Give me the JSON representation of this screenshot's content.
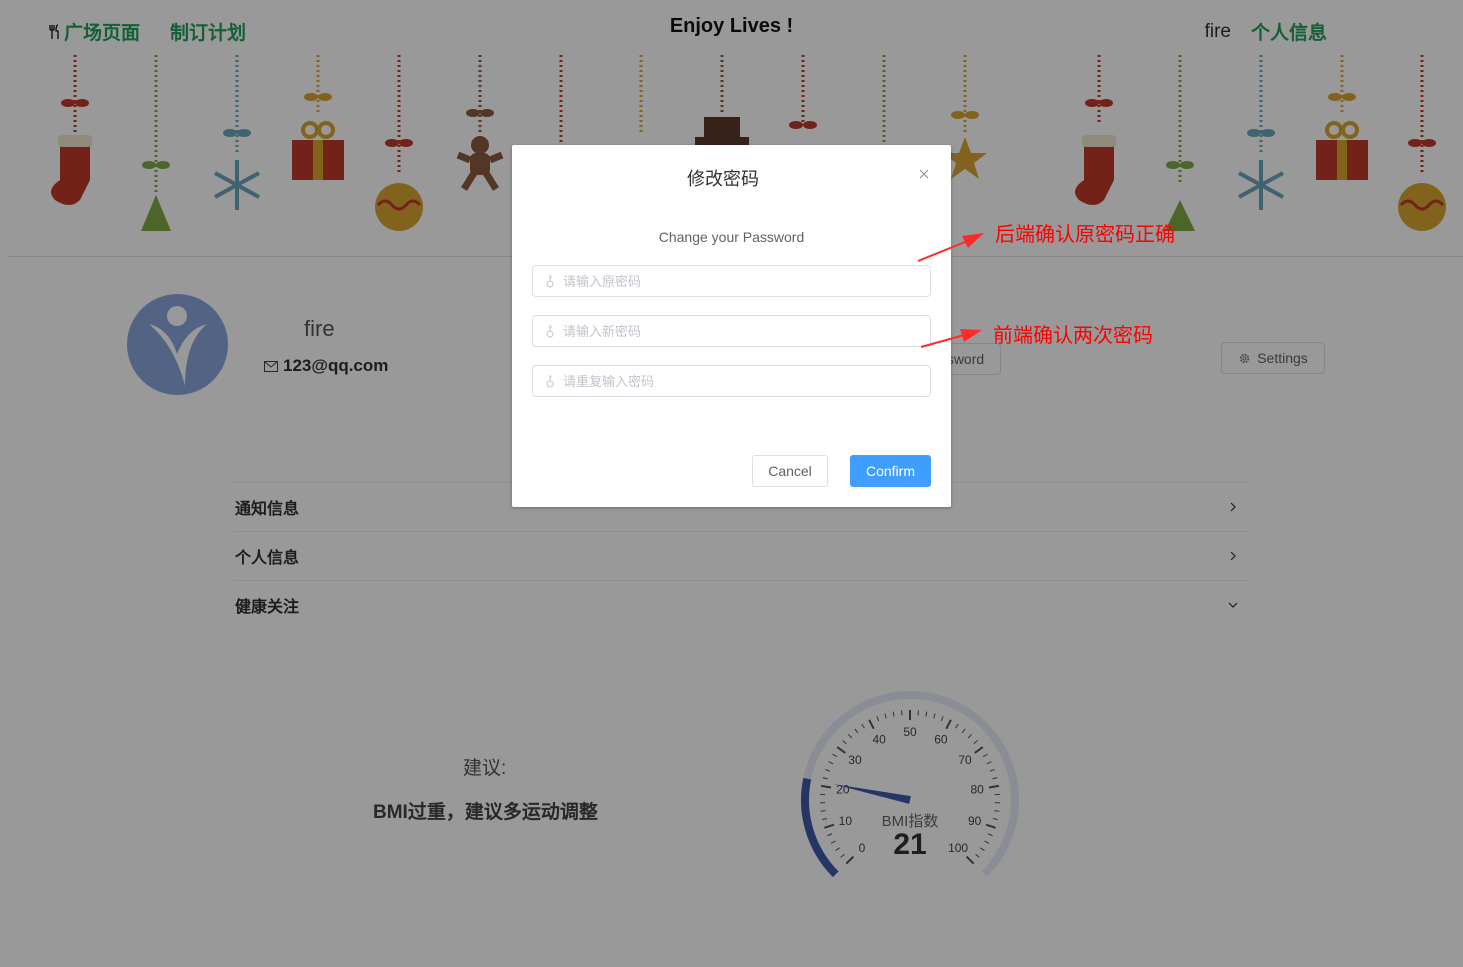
{
  "header": {
    "nav_left": [
      {
        "label": "广场页面",
        "icon": "fork-knife-icon"
      },
      {
        "label": "制订计划"
      }
    ],
    "title": "Enjoy Lives !",
    "username": "fire",
    "profile_link": "个人信息",
    "accent_color": "#21a05b"
  },
  "profile": {
    "name": "fire",
    "email": "123@qq.com",
    "password_button_partial": "sword",
    "settings_button": "Settings"
  },
  "sections": [
    {
      "title": "通知信息",
      "icon": "chevron-right-icon"
    },
    {
      "title": "个人信息",
      "icon": "chevron-right-icon"
    },
    {
      "title": "健康关注",
      "icon": "chevron-down-icon"
    }
  ],
  "advice": {
    "label": "建议:",
    "text": "BMI过重，建议多运动调整"
  },
  "gauge": {
    "title": "BMI指数",
    "value": 21,
    "min": 0,
    "max": 100,
    "ticks": [
      "0",
      "10",
      "20",
      "30",
      "40",
      "50",
      "60",
      "70",
      "80",
      "90",
      "100"
    ],
    "color": "#3e5bab"
  },
  "dialog": {
    "title": "修改密码",
    "subtitle": "Change your Password",
    "fields": [
      {
        "placeholder": "请输入原密码"
      },
      {
        "placeholder": "请输入新密码"
      },
      {
        "placeholder": "请重复输入密码"
      }
    ],
    "cancel_label": "Cancel",
    "confirm_label": "Confirm",
    "confirm_color": "#409eff"
  },
  "annotations": [
    {
      "text": "后端确认原密码正确",
      "color": "#ff0000"
    },
    {
      "text": "前端确认两次密码",
      "color": "#ff0000"
    }
  ]
}
